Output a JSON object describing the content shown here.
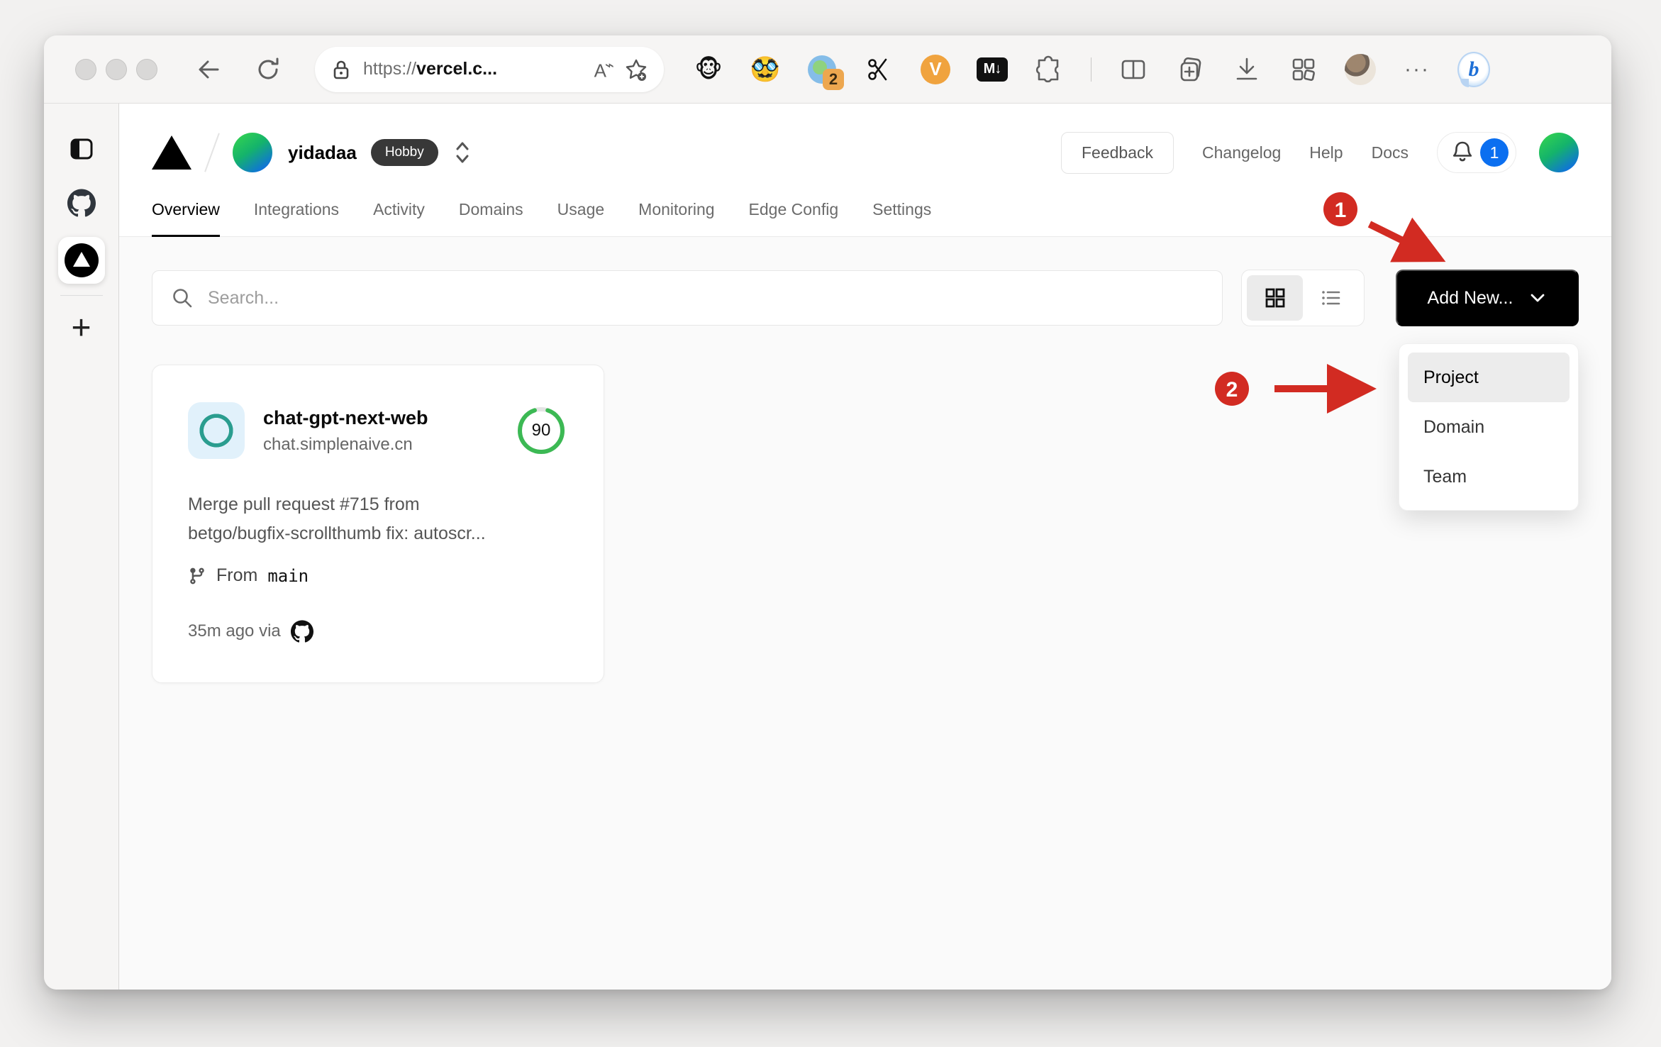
{
  "colors": {
    "annotation_red": "#d22b22",
    "score_green": "#3cb954",
    "badge_blue": "#0b6ff0",
    "openai_teal": "#2a9d8f",
    "accent_black": "#000000"
  },
  "browser_chrome": {
    "url_scheme": "https://",
    "url_host": "vercel.c...",
    "read_aloud_label": "A",
    "extension_badge_count": "2",
    "v_ext_label": "V",
    "markdown_ext_label": "M↓",
    "monkey_ext_emoji": "🐵",
    "face_ext_emoji": "🥸",
    "overflow_dots": "···",
    "bing_label": "b"
  },
  "edge_sidebar": {
    "plus_label": "+"
  },
  "vercel": {
    "team_name": "yidadaa",
    "plan_badge": "Hobby",
    "header_links": [
      "Feedback",
      "Changelog",
      "Help",
      "Docs"
    ],
    "notification_count": "1",
    "tabs": [
      "Overview",
      "Integrations",
      "Activity",
      "Domains",
      "Usage",
      "Monitoring",
      "Edge Config",
      "Settings"
    ],
    "active_tab": "Overview",
    "search_placeholder": "Search...",
    "add_new_label": "Add New...",
    "dropdown_menu": {
      "items": [
        "Project",
        "Domain",
        "Team"
      ],
      "highlighted": "Project"
    },
    "project_card": {
      "name": "chat-gpt-next-web",
      "domain": "chat.simplenaive.cn",
      "score": "90",
      "commit_line1": "Merge pull request #715 from",
      "commit_line2": "betgo/bugfix-scrollthumb fix: autoscr...",
      "branch_label": "From",
      "branch_name": "main",
      "deploy_meta": "35m ago via"
    }
  },
  "annotations": {
    "step_1": "1",
    "step_2": "2"
  }
}
